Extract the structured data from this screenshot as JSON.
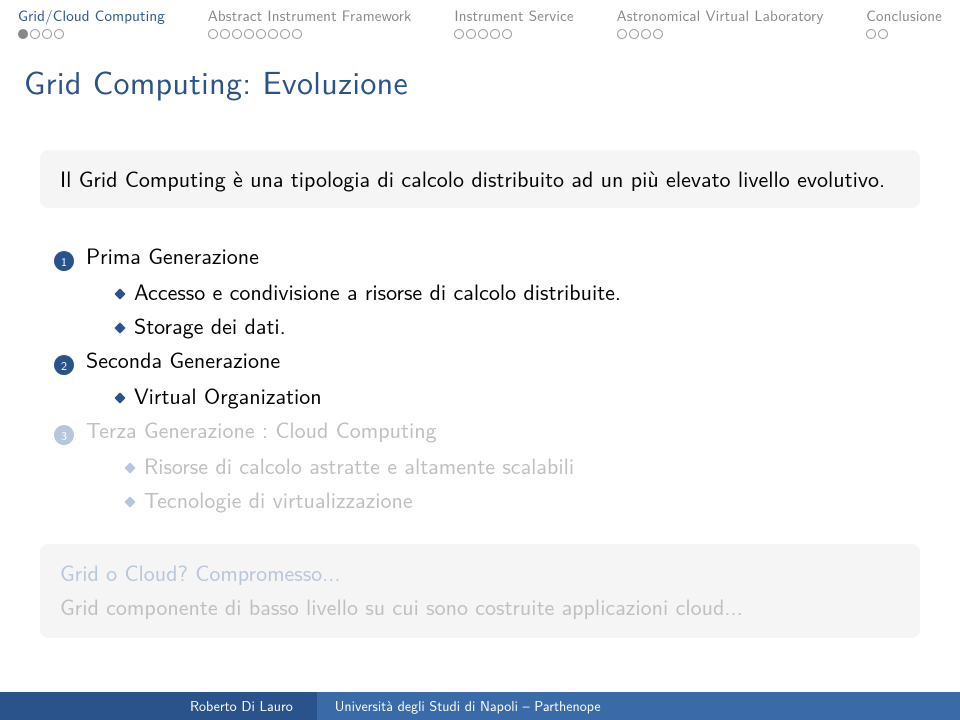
{
  "nav": {
    "items": [
      {
        "label": "Grid/Cloud Computing",
        "active": true,
        "dots": [
          true,
          false,
          false,
          false
        ]
      },
      {
        "label": "Abstract Instrument Framework",
        "active": false,
        "dots": [
          false,
          false,
          false,
          false,
          false,
          false,
          false,
          false
        ]
      },
      {
        "label": "Instrument Service",
        "active": false,
        "dots": [
          false,
          false,
          false,
          false,
          false
        ]
      },
      {
        "label": "Astronomical Virtual Laboratory",
        "active": false,
        "dots": [
          false,
          false,
          false,
          false
        ]
      },
      {
        "label": "Conclusione",
        "active": false,
        "dots": [
          false,
          false
        ]
      }
    ]
  },
  "title": "Grid Computing: Evoluzione",
  "intro": "Il Grid Computing è una tipologia di calcolo distribuito ad un più elevato livello evolutivo.",
  "generations": [
    {
      "num": "1",
      "label": "Prima Generazione",
      "faded": false,
      "subs": [
        {
          "text": "Accesso e condivisione a risorse di calcolo distribuite.",
          "faded": false
        },
        {
          "text": "Storage dei dati.",
          "faded": false
        }
      ]
    },
    {
      "num": "2",
      "label": "Seconda Generazione",
      "faded": false,
      "subs": [
        {
          "text": "Virtual Organization",
          "faded": false
        }
      ]
    },
    {
      "num": "3",
      "label": "Terza Generazione : Cloud Computing",
      "faded": true,
      "subs": [
        {
          "text": "Risorse di calcolo astratte e altamente scalabili",
          "faded": true
        },
        {
          "text": "Tecnologie di virtualizzazione",
          "faded": true
        }
      ]
    }
  ],
  "conclusion": {
    "title": "Grid o Cloud? Compromesso...",
    "text": "Grid componente di basso livello su cui sono costruite applicazioni cloud..."
  },
  "footer": {
    "author": "Roberto Di Lauro",
    "affiliation": "Università degli Studi di Napoli – Parthenope"
  }
}
